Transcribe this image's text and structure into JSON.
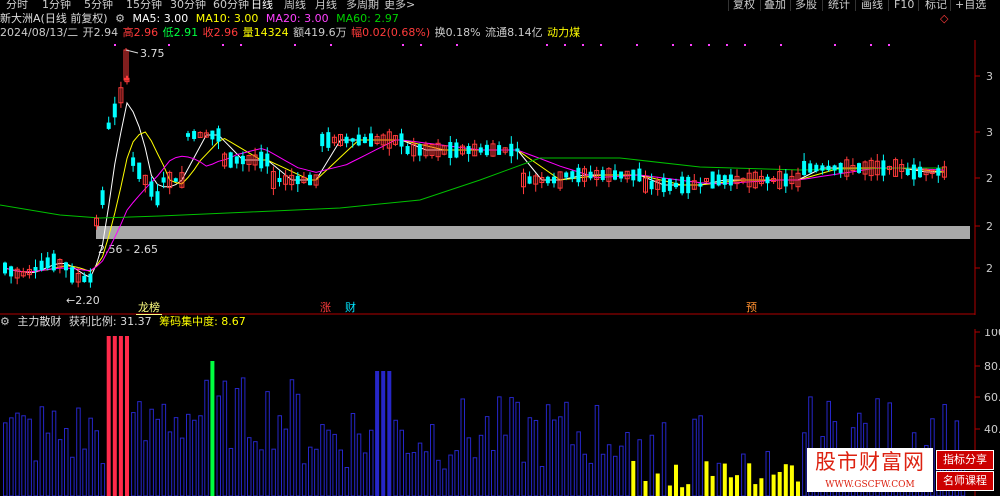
{
  "toolbar": {
    "periods": [
      "分时",
      "1分钟",
      "5分钟",
      "15分钟",
      "30分钟",
      "60分钟",
      "日线",
      "周线",
      "月线",
      "多周期",
      "更多>"
    ],
    "active_period": "日线",
    "right_buttons": [
      "复权",
      "叠加",
      "多股",
      "统计",
      "画线",
      "F10",
      "标记",
      "+自选",
      "◇"
    ]
  },
  "info": {
    "name": "新大洲A(日线 前复权)",
    "ma5": "MA5: 3.00",
    "ma10": "MA10: 3.00",
    "ma20": "MA20: 3.00",
    "ma60": "MA60: 2.97"
  },
  "price": {
    "date": "2024/08/13/二",
    "open": "开2.94",
    "high": "高2.96",
    "low": "低2.91",
    "close": "收2.96",
    "vol": "量14324",
    "amount": "额419.6万",
    "change": "幅0.02(0.68%)",
    "turnover": "换0.18%",
    "float": "流通8.14亿",
    "concept": "动力煤"
  },
  "annotations": {
    "high_label": "3.75",
    "low_label": "←2.20",
    "band_label": "2.56 - 2.65"
  },
  "events": {
    "e1": "龙榜",
    "e2": "涨",
    "e3": "财",
    "e4": "预"
  },
  "right_axis": [
    "3",
    "3",
    "2",
    "2",
    "2"
  ],
  "sub": {
    "name": "主力散财",
    "profit": "获利比例: 31.37",
    "chip": "筹码集中度: 8.67",
    "axis": [
      "100",
      "80.",
      "60.",
      "40."
    ]
  },
  "watermark": {
    "site": "股市财富网",
    "url": "WWW.GSCFW.COM",
    "tag1": "指标分享",
    "tag2": "名师课程"
  },
  "colors": {
    "up": "#ff3b3b",
    "down": "#00ffff",
    "ma5": "#ffffff",
    "ma10": "#ffff00",
    "ma20": "#ff00ff",
    "ma60": "#00c000",
    "volume_blue": "#2626c8",
    "volume_red": "#ff2a4a",
    "volume_green": "#00ff40",
    "volume_yellow": "#ffff00"
  }
}
